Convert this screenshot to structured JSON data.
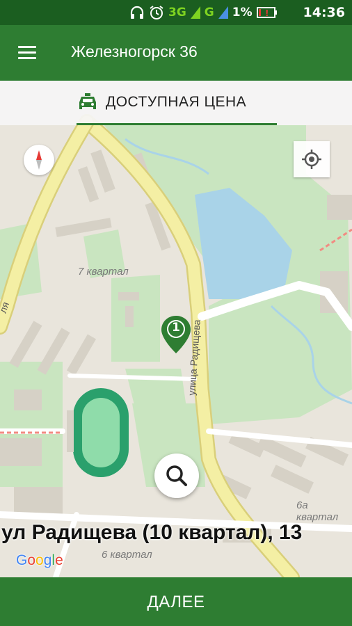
{
  "status_bar": {
    "network_label": "3G",
    "signal_label": "G",
    "battery_percent": "1%",
    "time": "14:36",
    "icons": [
      "headphones-icon",
      "alarm-icon",
      "signal-icon",
      "battery-icon"
    ]
  },
  "app_bar": {
    "title": "Железногорск 36",
    "menu_icon": "menu-icon"
  },
  "tabs": [
    {
      "label": "ДОСТУПНАЯ ЦЕНА",
      "icon": "taxi-icon",
      "selected": true
    }
  ],
  "map": {
    "labels": {
      "kvartal_7": "7 квартал",
      "street_radishcheva": "улица Радищева",
      "kvartal_6a": "6а квартал",
      "kvartal_6": "6 квартал",
      "street_partial": "ля"
    },
    "pin_number": "1",
    "address": "ул Радищева (10 квартал), 13",
    "attribution": {
      "text": "Google",
      "letters": [
        "G",
        "o",
        "o",
        "g",
        "l",
        "e"
      ],
      "colors": [
        "#4285F4",
        "#EA4335",
        "#FBBC05",
        "#4285F4",
        "#34A853",
        "#EA4335"
      ]
    }
  },
  "bottom": {
    "next_label": "ДАЛЕЕ"
  },
  "colors": {
    "primary": "#2e7d32",
    "status_bar": "#1b5e20",
    "road": "#f4efa4",
    "park": "#c9e5c0",
    "water": "#a9d3e8"
  }
}
